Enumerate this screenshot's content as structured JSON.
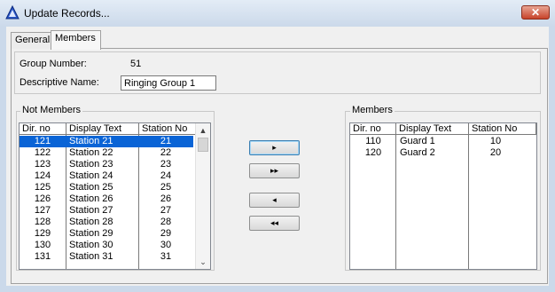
{
  "window": {
    "title": "Update Records...",
    "close_glyph": "✕",
    "icon": "delta-triangle-icon"
  },
  "tabs": [
    {
      "label": "General",
      "active": false
    },
    {
      "label": "Members",
      "active": true
    }
  ],
  "group": {
    "number_label": "Group Number:",
    "number_value": "51",
    "name_label": "Descriptive Name:",
    "name_value": "Ringing Group 1"
  },
  "not_members": {
    "title": "Not Members",
    "columns": [
      "Dir. no",
      "Display Text",
      "Station No"
    ],
    "selected_index": 0,
    "rows": [
      {
        "dir": "121",
        "text": "Station 21",
        "station": "21"
      },
      {
        "dir": "122",
        "text": "Station 22",
        "station": "22"
      },
      {
        "dir": "123",
        "text": "Station 23",
        "station": "23"
      },
      {
        "dir": "124",
        "text": "Station 24",
        "station": "24"
      },
      {
        "dir": "125",
        "text": "Station 25",
        "station": "25"
      },
      {
        "dir": "126",
        "text": "Station 26",
        "station": "26"
      },
      {
        "dir": "127",
        "text": "Station 27",
        "station": "27"
      },
      {
        "dir": "128",
        "text": "Station 28",
        "station": "28"
      },
      {
        "dir": "129",
        "text": "Station 29",
        "station": "29"
      },
      {
        "dir": "130",
        "text": "Station 30",
        "station": "30"
      },
      {
        "dir": "131",
        "text": "Station 31",
        "station": "31"
      }
    ]
  },
  "buttons": {
    "add_one": "▸",
    "add_all": "▸▸",
    "remove_one": "◂",
    "remove_all": "◂◂"
  },
  "members": {
    "title": "Members",
    "columns": [
      "Dir. no",
      "Display Text",
      "Station No"
    ],
    "rows": [
      {
        "dir": "110",
        "text": "Guard 1",
        "station": "10"
      },
      {
        "dir": "120",
        "text": "Guard 2",
        "station": "20"
      }
    ]
  },
  "colors": {
    "selection": "#0a64d6",
    "close_button": "#c7432a",
    "title_bar": "#cbd9ea"
  }
}
